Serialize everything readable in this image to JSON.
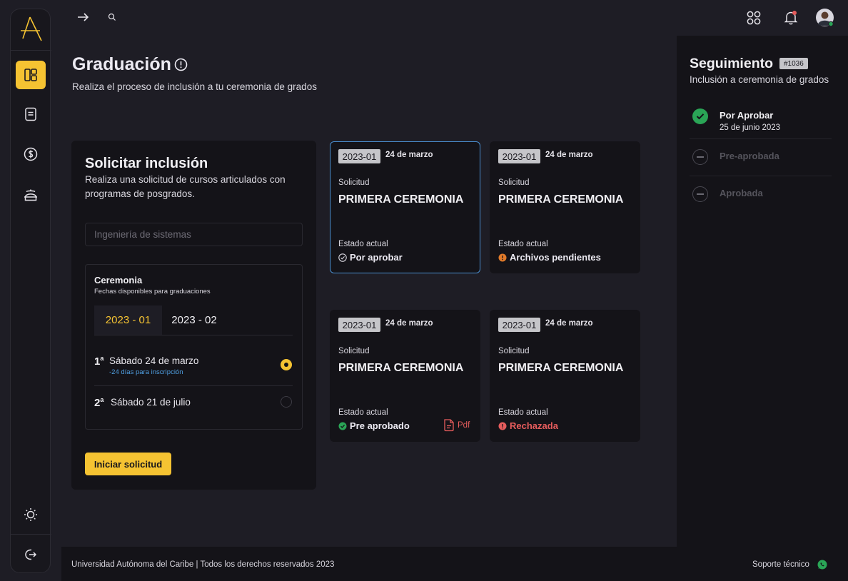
{
  "colors": {
    "accent": "#f5c332",
    "success": "#2aa556",
    "warning": "#e07a2a",
    "danger": "#e55c5c",
    "link": "#4f9ee0"
  },
  "sidebar": {
    "logo_icon": "triangle-logo-icon",
    "items": [
      {
        "icon": "dashboard-icon",
        "active": true
      },
      {
        "icon": "document-icon",
        "active": false
      },
      {
        "icon": "dollar-icon",
        "active": false
      },
      {
        "icon": "academic-icon",
        "active": false
      }
    ],
    "bottom": [
      {
        "icon": "sun-icon"
      },
      {
        "icon": "logout-icon"
      }
    ]
  },
  "topbar": {
    "icons": [
      "arrow-right-icon",
      "search-icon",
      "apps-grid-icon",
      "bell-icon",
      "avatar"
    ]
  },
  "header": {
    "title": "Graduación",
    "subtitle": "Realiza el proceso de inclusión a tu ceremonia de grados"
  },
  "request": {
    "title": "Solicitar inclusión",
    "description": "Realiza una solicitud de cursos articulados con programas de posgrados.",
    "career_placeholder": "Ingeniería de sistemas",
    "ceremony": {
      "title": "Ceremonia",
      "subtitle": "Fechas disponibles para graduaciones",
      "tabs": [
        {
          "label": "2023 - 01",
          "active": true
        },
        {
          "label": "2023 - 02",
          "active": false
        }
      ],
      "options": [
        {
          "num": "1",
          "sup": "a",
          "label": "Sábado 24 de marzo",
          "note": "-24 días para inscripción",
          "selected": true
        },
        {
          "num": "2",
          "sup": "a",
          "label": "Sábado 21 de julio",
          "note": "",
          "selected": false
        }
      ]
    },
    "button": "Iniciar solicitud"
  },
  "cards": [
    {
      "period": "2023-01",
      "date": "24 de marzo",
      "kind": "Solicitud",
      "name": "PRIMERA CEREMONIA",
      "state_label": "Estado actual",
      "state": "Por aprobar",
      "state_icon": "check-circle-outline-icon",
      "selected": true
    },
    {
      "period": "2023-01",
      "date": "24 de marzo",
      "kind": "Solicitud",
      "name": "PRIMERA CEREMONIA",
      "state_label": "Estado actual",
      "state": "Archivos pendientes",
      "state_icon": "warning-icon",
      "selected": false
    },
    {
      "period": "2023-01",
      "date": "24 de marzo",
      "kind": "Solicitud",
      "name": "PRIMERA CEREMONIA",
      "state_label": "Estado actual",
      "state": "Pre aprobado",
      "state_icon": "check-circle-icon",
      "selected": false,
      "pdf": "Pdf"
    },
    {
      "period": "2023-01",
      "date": "24 de marzo",
      "kind": "Solicitud",
      "name": "PRIMERA CEREMONIA",
      "state_label": "Estado actual",
      "state": "Rechazada",
      "state_icon": "error-icon",
      "selected": false
    }
  ],
  "tracking": {
    "title": "Seguimiento",
    "badge": "#1036",
    "subtitle": "Inclusión a ceremonia de grados",
    "steps": [
      {
        "label": "Por Aprobar",
        "date": "25 de junio 2023",
        "done": true
      },
      {
        "label": "Pre-aprobada",
        "date": "",
        "done": false
      },
      {
        "label": "Aprobada",
        "date": "",
        "done": false
      }
    ]
  },
  "footer": {
    "university": "Universidad Autónoma del Caribe",
    "rights": "Todos los derechos reservados  2023",
    "support": "Soporte técnico"
  }
}
